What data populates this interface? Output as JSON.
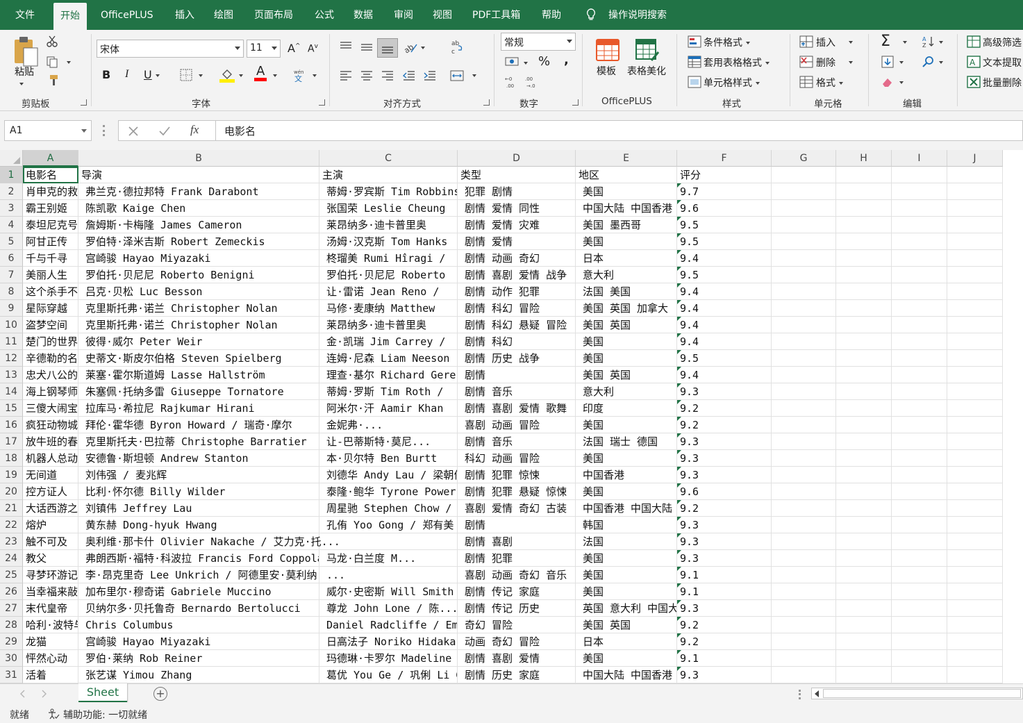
{
  "menu": {
    "tabs": [
      "文件",
      "开始",
      "OfficePLUS",
      "插入",
      "绘图",
      "页面布局",
      "公式",
      "数据",
      "审阅",
      "视图",
      "PDF工具箱",
      "帮助"
    ],
    "active_tab": "开始",
    "search_label": "操作说明搜索"
  },
  "ribbon": {
    "clipboard": {
      "paste_label": "粘贴",
      "group_label": "剪贴板"
    },
    "font": {
      "font_name": "宋体",
      "font_size": "11",
      "group_label": "字体",
      "bold": "B",
      "italic": "I",
      "underline": "U",
      "grow": "A",
      "shrink": "A",
      "font_color": "A",
      "fill_color": "#ffef00",
      "text_color": "#ff0000"
    },
    "alignment": {
      "group_label": "对齐方式"
    },
    "number": {
      "format": "常规",
      "percent": "%",
      "comma": ",",
      "group_label": "数字"
    },
    "officeplus": {
      "template_label": "模板",
      "table_beautify_label": "表格美化",
      "group_label": "OfficePLUS"
    },
    "styles": {
      "conditional": "条件格式",
      "table_format": "套用表格格式",
      "cell_style": "单元格样式",
      "group_label": "样式"
    },
    "cells": {
      "insert": "插入",
      "delete": "删除",
      "format": "格式",
      "group_label": "单元格"
    },
    "editing": {
      "group_label": "编辑"
    },
    "extra": {
      "advanced_filter": "高级筛选",
      "text_extract": "文本提取",
      "batch_delete": "批量删除"
    }
  },
  "formula_bar": {
    "name_box": "A1",
    "fx": "fx",
    "content": "电影名"
  },
  "grid": {
    "columns": [
      "A",
      "B",
      "C",
      "D",
      "E",
      "F",
      "G",
      "H",
      "I",
      "J"
    ],
    "selected_cell": "A1",
    "headers": [
      "电影名",
      "导演",
      "主演",
      "类型",
      "地区",
      "评分"
    ],
    "rows": [
      [
        "肖申克的救赎",
        "弗兰克·德拉邦特 Frank Darabont",
        "蒂姆·罗宾斯 Tim Robbins",
        "犯罪 剧情",
        "美国",
        "9.7"
      ],
      [
        "霸王别姬",
        "陈凯歌 Kaige Chen",
        "张国荣 Leslie Cheung",
        "剧情 爱情 同性",
        "中国大陆 中国香港",
        "9.6"
      ],
      [
        "泰坦尼克号",
        "詹姆斯·卡梅隆 James Cameron",
        "莱昂纳多·迪卡普里奥",
        "剧情 爱情 灾难",
        "美国 墨西哥",
        "9.5"
      ],
      [
        "阿甘正传",
        "罗伯特·泽米吉斯 Robert Zemeckis",
        "汤姆·汉克斯 Tom Hanks",
        "剧情 爱情",
        "美国",
        "9.5"
      ],
      [
        "千与千寻",
        "宫崎骏 Hayao Miyazaki",
        "柊瑠美 Rumi Hîragi /",
        "剧情 动画 奇幻",
        "日本",
        "9.4"
      ],
      [
        "美丽人生",
        "罗伯托·贝尼尼 Roberto Benigni",
        "罗伯托·贝尼尼 Roberto",
        "剧情 喜剧 爱情 战争",
        "意大利",
        "9.5"
      ],
      [
        "这个杀手不太冷",
        "吕克·贝松 Luc Besson",
        "让·雷诺 Jean Reno /",
        "剧情 动作 犯罪",
        "法国 美国",
        "9.4"
      ],
      [
        "星际穿越",
        "克里斯托弗·诺兰 Christopher Nolan",
        "马修·麦康纳 Matthew",
        "剧情 科幻 冒险",
        "美国 英国 加拿大",
        "9.4"
      ],
      [
        "盗梦空间",
        "克里斯托弗·诺兰 Christopher Nolan",
        "莱昂纳多·迪卡普里奥",
        "剧情 科幻 悬疑 冒险",
        "美国 英国",
        "9.4"
      ],
      [
        "楚门的世界",
        "彼得·威尔 Peter Weir",
        "金·凯瑞 Jim Carrey /",
        "剧情 科幻",
        "美国",
        "9.4"
      ],
      [
        "辛德勒的名单",
        "史蒂文·斯皮尔伯格 Steven Spielberg",
        "连姆·尼森 Liam Neeson",
        "剧情 历史 战争",
        "美国",
        "9.5"
      ],
      [
        "忠犬八公的故事",
        "莱塞·霍尔斯道姆 Lasse Hallström",
        "理查·基尔 Richard Gere",
        "剧情",
        "美国 英国",
        "9.4"
      ],
      [
        "海上钢琴师",
        "朱塞佩·托纳多雷 Giuseppe Tornatore",
        "蒂姆·罗斯 Tim Roth /",
        "剧情 音乐",
        "意大利",
        "9.3"
      ],
      [
        "三傻大闹宝莱坞",
        "拉库马·希拉尼 Rajkumar Hirani",
        "阿米尔·汗 Aamir Khan",
        "剧情 喜剧 爱情 歌舞",
        "印度",
        "9.2"
      ],
      [
        "疯狂动物城",
        "拜伦·霍华德 Byron Howard / 瑞奇·摩尔",
        "金妮弗·...",
        "喜剧 动画 冒险",
        "美国",
        "9.2"
      ],
      [
        "放牛班的春天",
        "克里斯托夫·巴拉蒂 Christophe Barratier",
        "让-巴蒂斯特·莫尼...",
        "剧情 音乐",
        "法国 瑞士 德国",
        "9.3"
      ],
      [
        "机器人总动员",
        "安德鲁·斯坦顿 Andrew Stanton",
        "本·贝尔特 Ben Burtt",
        "科幻 动画 冒险",
        "美国",
        "9.3"
      ],
      [
        "无间道",
        "刘伟强 / 麦兆辉",
        "刘德华 Andy Lau / 梁朝伟",
        "剧情 犯罪 惊悚",
        "中国香港",
        "9.3"
      ],
      [
        "控方证人",
        "比利·怀尔德 Billy Wilder",
        "泰隆·鲍华 Tyrone Power",
        "剧情 犯罪 悬疑 惊悚",
        "美国",
        "9.6"
      ],
      [
        "大话西游之大圣娶亲",
        "刘镇伟 Jeffrey Lau",
        "周星驰 Stephen Chow /",
        "喜剧 爱情 奇幻 古装",
        "中国香港 中国大陆",
        "9.2"
      ],
      [
        "熔炉",
        "黄东赫 Dong-hyuk Hwang",
        "孔侑 Yoo Gong / 郑有美",
        "剧情",
        "韩国",
        "9.3"
      ],
      [
        "触不可及",
        "奥利维·那卡什 Olivier Nakache / 艾力克·托...",
        "",
        "剧情 喜剧",
        "法国",
        "9.3"
      ],
      [
        "教父",
        "弗朗西斯·福特·科波拉 Francis Ford Coppola",
        "马龙·白兰度 M...",
        "剧情 犯罪",
        "美国",
        "9.3"
      ],
      [
        "寻梦环游记",
        "李·昂克里奇 Lee Unkrich / 阿德里安·莫利纳",
        "...",
        "喜剧 动画 奇幻 音乐",
        "美国",
        "9.1"
      ],
      [
        "当幸福来敲门",
        "加布里尔·穆奇诺 Gabriele Muccino",
        "威尔·史密斯 Will Smith",
        "剧情 传记 家庭",
        "美国",
        "9.1"
      ],
      [
        "末代皇帝",
        "贝纳尔多·贝托鲁奇 Bernardo Bertolucci",
        "尊龙 John Lone / 陈...",
        "剧情 传记 历史",
        "英国 意大利 中国大陆",
        "9.3"
      ],
      [
        "哈利·波特与魔法石",
        "Chris Columbus",
        "Daniel Radcliffe / Emma",
        "奇幻 冒险",
        "美国 英国",
        "9.2"
      ],
      [
        "龙猫",
        "宫崎骏 Hayao Miyazaki",
        "日高法子 Noriko Hidaka",
        "动画 奇幻 冒险",
        "日本",
        "9.2"
      ],
      [
        "怦然心动",
        "罗伯·莱纳 Rob Reiner",
        "玛德琳·卡罗尔 Madeline",
        "剧情 喜剧 爱情",
        "美国",
        "9.1"
      ],
      [
        "活着",
        "张艺谋 Yimou Zhang",
        "葛优 You Ge / 巩俐 Li Gong",
        "剧情 历史 家庭",
        "中国大陆 中国香港",
        "9.3"
      ]
    ]
  },
  "sheet_tabs": {
    "active": "Sheet",
    "add_label": "+"
  },
  "status": {
    "ready": "就绪",
    "accessibility": "辅助功能: 一切就绪"
  }
}
